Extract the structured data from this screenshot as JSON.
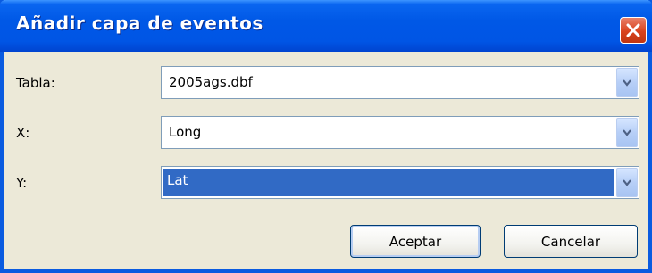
{
  "window": {
    "title": "Añadir capa de eventos"
  },
  "form": {
    "rows": [
      {
        "label": "Tabla:",
        "value": "2005ags.dbf"
      },
      {
        "label": "X:",
        "value": "Long"
      },
      {
        "label": "Y:",
        "value": "Lat"
      }
    ]
  },
  "buttons": {
    "ok": "Aceptar",
    "cancel": "Cancelar"
  },
  "icons": {
    "close": "close-icon",
    "dropdown": "chevron-down-icon"
  },
  "colors": {
    "titlebar": "#0055e5",
    "close": "#d9421c",
    "selection": "#316ac5",
    "dialog_bg": "#ece9d8"
  }
}
